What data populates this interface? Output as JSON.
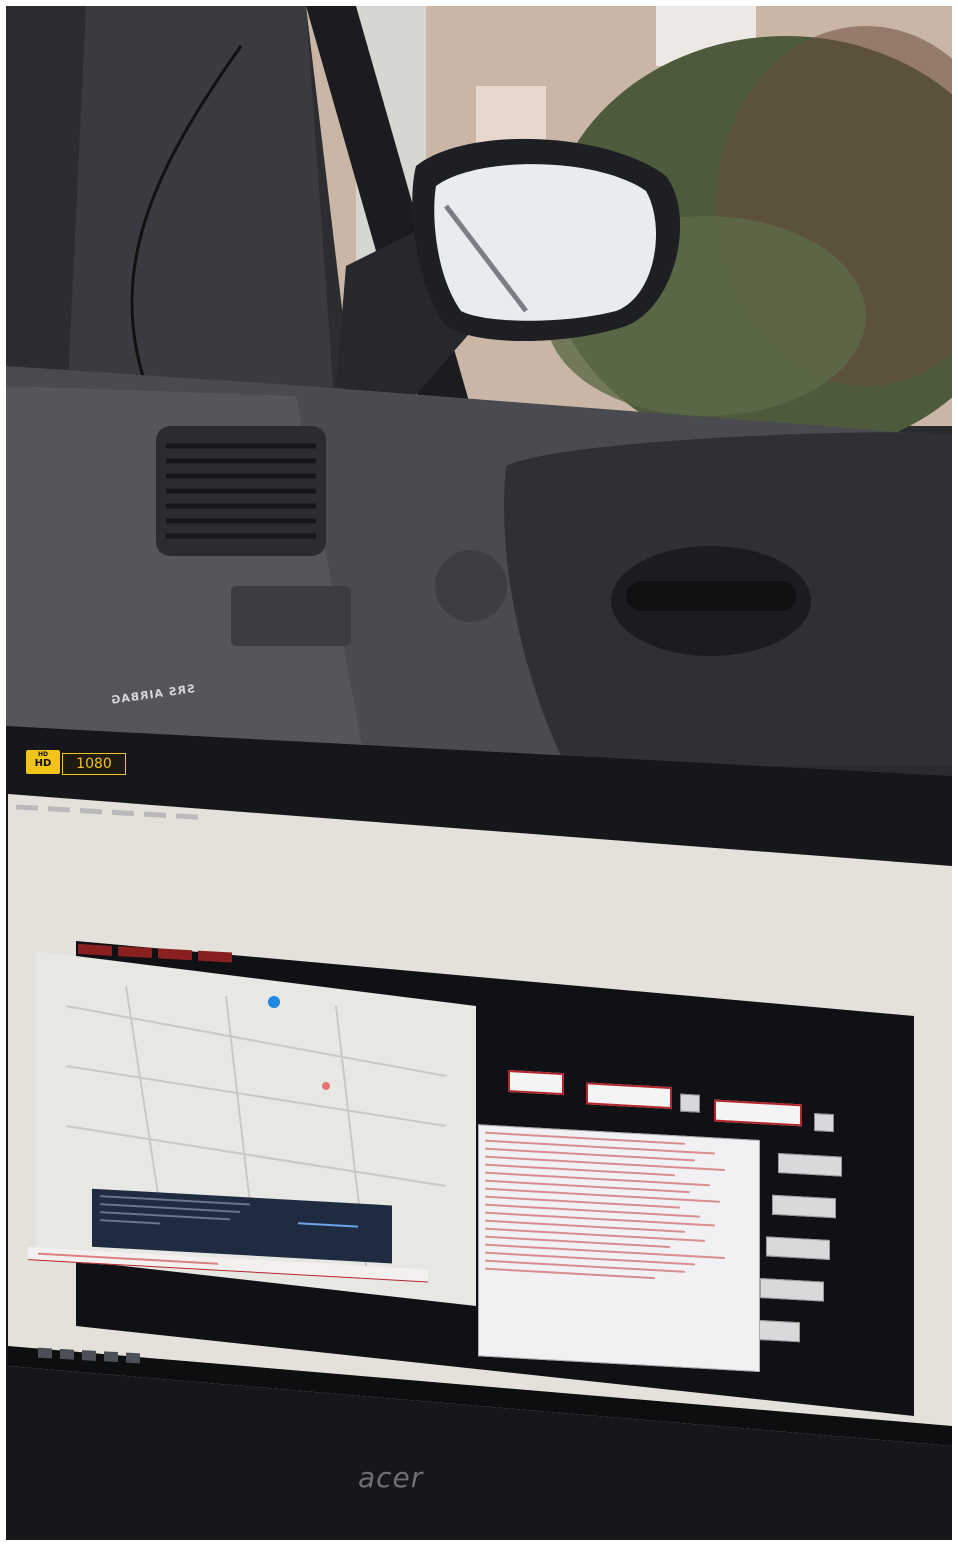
{
  "overlay": {
    "hd_badge": {
      "top": "HD",
      "bottom": "HD"
    },
    "resolution": "1080"
  },
  "vehicle": {
    "airbag_label": "SRS AIRBAG"
  },
  "laptop": {
    "brand": "acer"
  },
  "colors": {
    "app_accent": "#b3262c",
    "app_background": "#0f1115",
    "badge_yellow": "#f0c419"
  }
}
